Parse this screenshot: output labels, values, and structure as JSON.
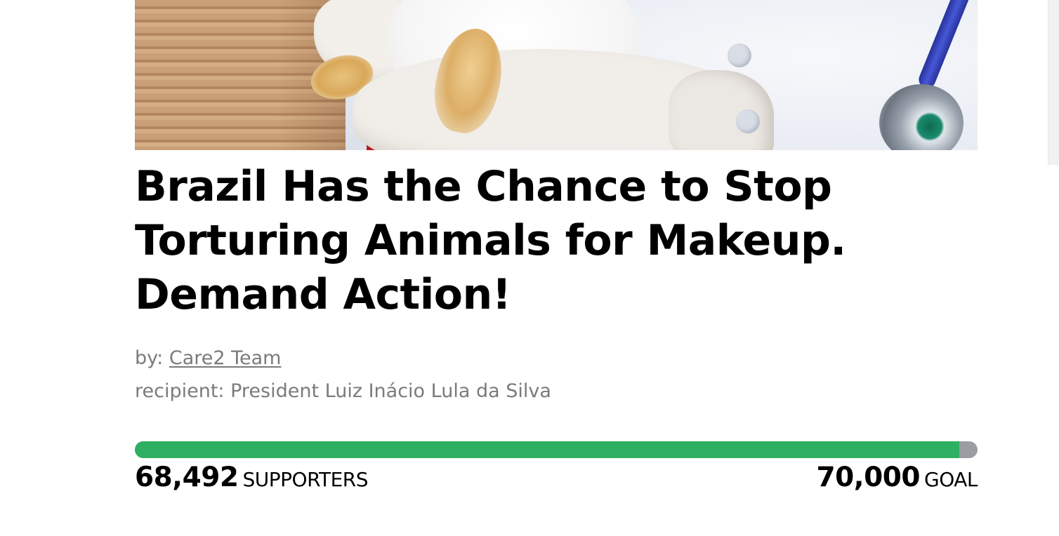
{
  "petition": {
    "title": "Brazil Has the Chance to Stop Torturing Animals for Makeup. Demand Action!",
    "by_prefix": "by:",
    "author": "Care2 Team",
    "recipient_label": "recipient:",
    "recipient": "President Luiz Inácio Lula da Silva"
  },
  "progress": {
    "supporters": "68,492",
    "supporters_label": "SUPPORTERS",
    "goal": "70,000",
    "goal_label": "GOAL",
    "fraction": 0.9785
  },
  "colors": {
    "progress_fill": "#2eaf62",
    "progress_track": "#9a9ea3",
    "meta_text": "#7b7b7b"
  }
}
